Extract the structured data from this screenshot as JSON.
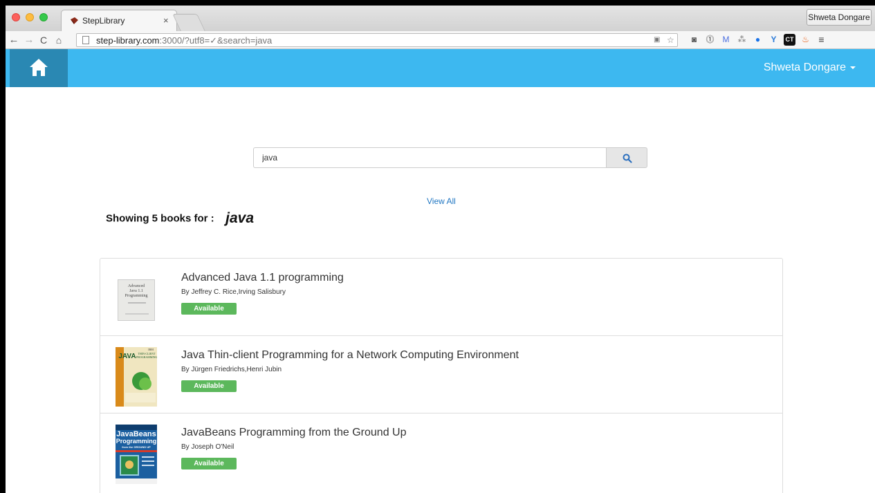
{
  "browser": {
    "tab_title": "StepLibrary",
    "tab_close": "×",
    "profile_name": "Shweta Dongare",
    "url_host": "step-library.com",
    "url_rest": ":3000/?utf8=✓&search=java"
  },
  "navbar": {
    "user_name": "Shweta Dongare"
  },
  "search": {
    "query": "java"
  },
  "view_all_label": "View All",
  "results_heading": {
    "label": "Showing 5 books for :",
    "term": "java"
  },
  "books": [
    {
      "title": "Advanced Java 1.1 programming",
      "authors": "By Jeffrey C. Rice,Irving Salisbury",
      "status": "Available",
      "cover_text": [
        "Advanced",
        "Java 1.1",
        "Programming"
      ]
    },
    {
      "title": "Java Thin-client Programming for a Network Computing Environment",
      "authors": "By Jürgen Friedrichs,Henri Jubin",
      "status": "Available",
      "cover_text": [
        "JAVA",
        "THIN-CLIENT",
        "PROGRAMMING",
        "IBM"
      ]
    },
    {
      "title": "JavaBeans Programming from the Ground Up",
      "authors": "By Joseph O'Neil",
      "status": "Available",
      "cover_text": [
        "JavaBeans",
        "Programming",
        "from the GROUND UP"
      ]
    }
  ],
  "colors": {
    "navbar": "#3db8f0",
    "home_tile": "#2a88b3",
    "badge": "#5cb85c",
    "link": "#1f76c2"
  }
}
